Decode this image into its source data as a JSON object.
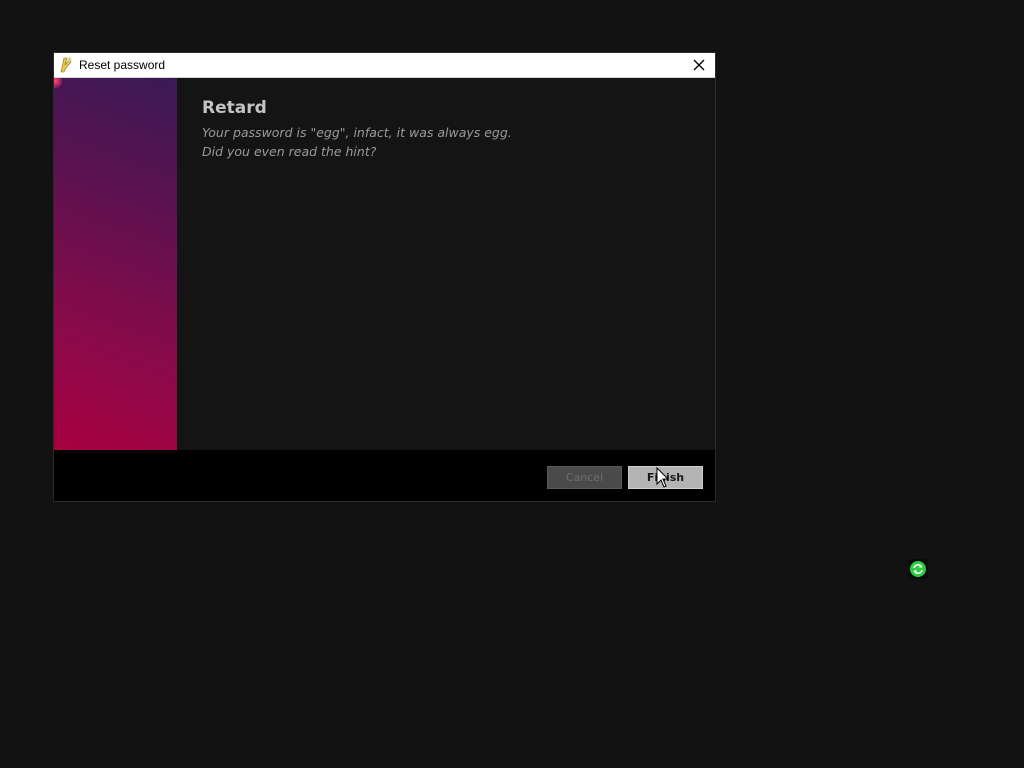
{
  "window": {
    "title": "Reset password",
    "close_label": "✕"
  },
  "content": {
    "heading": "Retard",
    "message_lines": [
      "Your password is \"egg\", infact, it was always egg.",
      "Did you even read the hint?"
    ]
  },
  "footer": {
    "cancel_label": "Cancel",
    "finish_label": "Finish",
    "cancel_enabled": false
  },
  "desktop": {
    "tray_icon": "green-refresh-icon"
  },
  "colors": {
    "desktop_bg": "#121212",
    "banner_top": "#3a1a55",
    "banner_bottom": "#a80040",
    "tray_icon_green": "#2ecc40"
  }
}
